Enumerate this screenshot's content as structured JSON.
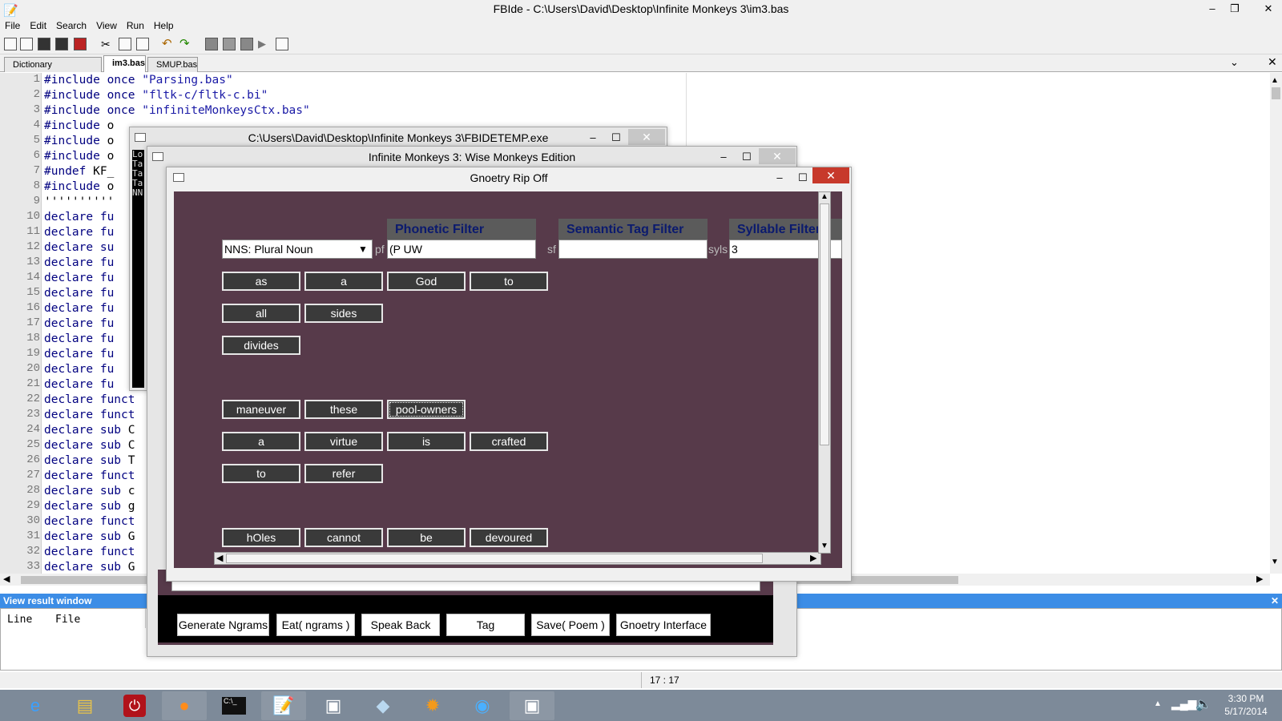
{
  "ide": {
    "title": "FBIde - C:\\Users\\David\\Desktop\\Infinite Monkeys 3\\im3.bas",
    "menu": [
      "File",
      "Edit",
      "Search",
      "View",
      "Run",
      "Help"
    ],
    "tabs": [
      "Dictionary Editor.bas",
      "im3.bas",
      "SMUP.bas"
    ],
    "active_tab": "im3.bas",
    "code_lines": [
      "#include once \"Parsing.bas\"",
      "#include once \"fltk-c/fltk-c.bi\"",
      "#include once \"infiniteMonkeysCtx.bas\"",
      "#include o",
      "#include o",
      "#include o",
      "#undef KF_",
      "#include o",
      "''''''''''",
      "declare fu",
      "declare fu",
      "declare su",
      "declare fu",
      "declare fu",
      "declare fu",
      "declare fu",
      "declare fu",
      "declare fu",
      "declare fu",
      "declare fu",
      "declare fu",
      "declare funct",
      "declare funct",
      "declare sub C",
      "declare sub C",
      "declare sub T",
      "declare funct",
      "declare sub c",
      "declare sub g",
      "declare funct",
      "declare sub G",
      "declare funct",
      "declare sub G"
    ],
    "result_window_title": "View result window",
    "result_columns": [
      "Line",
      "File"
    ],
    "status_position": "17 : 17"
  },
  "console_window": {
    "title": "C:\\Users\\David\\Desktop\\Infinite Monkeys 3\\FBIDETEMP.exe",
    "lines": [
      "Lo",
      "Ta",
      "Ta",
      "Ta",
      "NN"
    ]
  },
  "monkeys_window": {
    "title": "Infinite Monkeys 3: Wise Monkeys Edition",
    "bottom_buttons": [
      "Generate Ngrams",
      "Eat( ngrams )",
      "Speak Back",
      "Tag",
      "Save( Poem )",
      "Gnoetry Interface"
    ]
  },
  "gnoetry_window": {
    "title": "Gnoetry Rip Off",
    "pos_select": "NNS: Plural Noun",
    "phonetic_filter": {
      "header": "Phonetic Filter",
      "label": "pf",
      "value": "(P UW"
    },
    "semantic_filter": {
      "header": "Semantic Tag Filter",
      "label": "sf",
      "value": ""
    },
    "syllable_filter": {
      "header": "Syllable Filter",
      "label": "syls",
      "value": "3"
    },
    "word_rows": [
      [
        "as",
        "a",
        "God",
        "to"
      ],
      [
        "all",
        "sides"
      ],
      [
        "divides"
      ],
      [
        "maneuver",
        "these",
        "pool-owners"
      ],
      [
        "a",
        "virtue",
        "is",
        "crafted"
      ],
      [
        "to",
        "refer"
      ],
      [
        "hOles",
        "cannot",
        "be",
        "devoured"
      ]
    ],
    "selected_word": "pool-owners"
  },
  "taskbar": {
    "icons": [
      "ie-icon",
      "file-explorer-icon",
      "power-icon",
      "firefox-icon",
      "cmd-icon",
      "notepad-icon",
      "fbide-icon",
      "app-icon",
      "settings-icon",
      "media-icon",
      "window-icon"
    ],
    "time": "3:30 PM",
    "date": "5/17/2014"
  }
}
